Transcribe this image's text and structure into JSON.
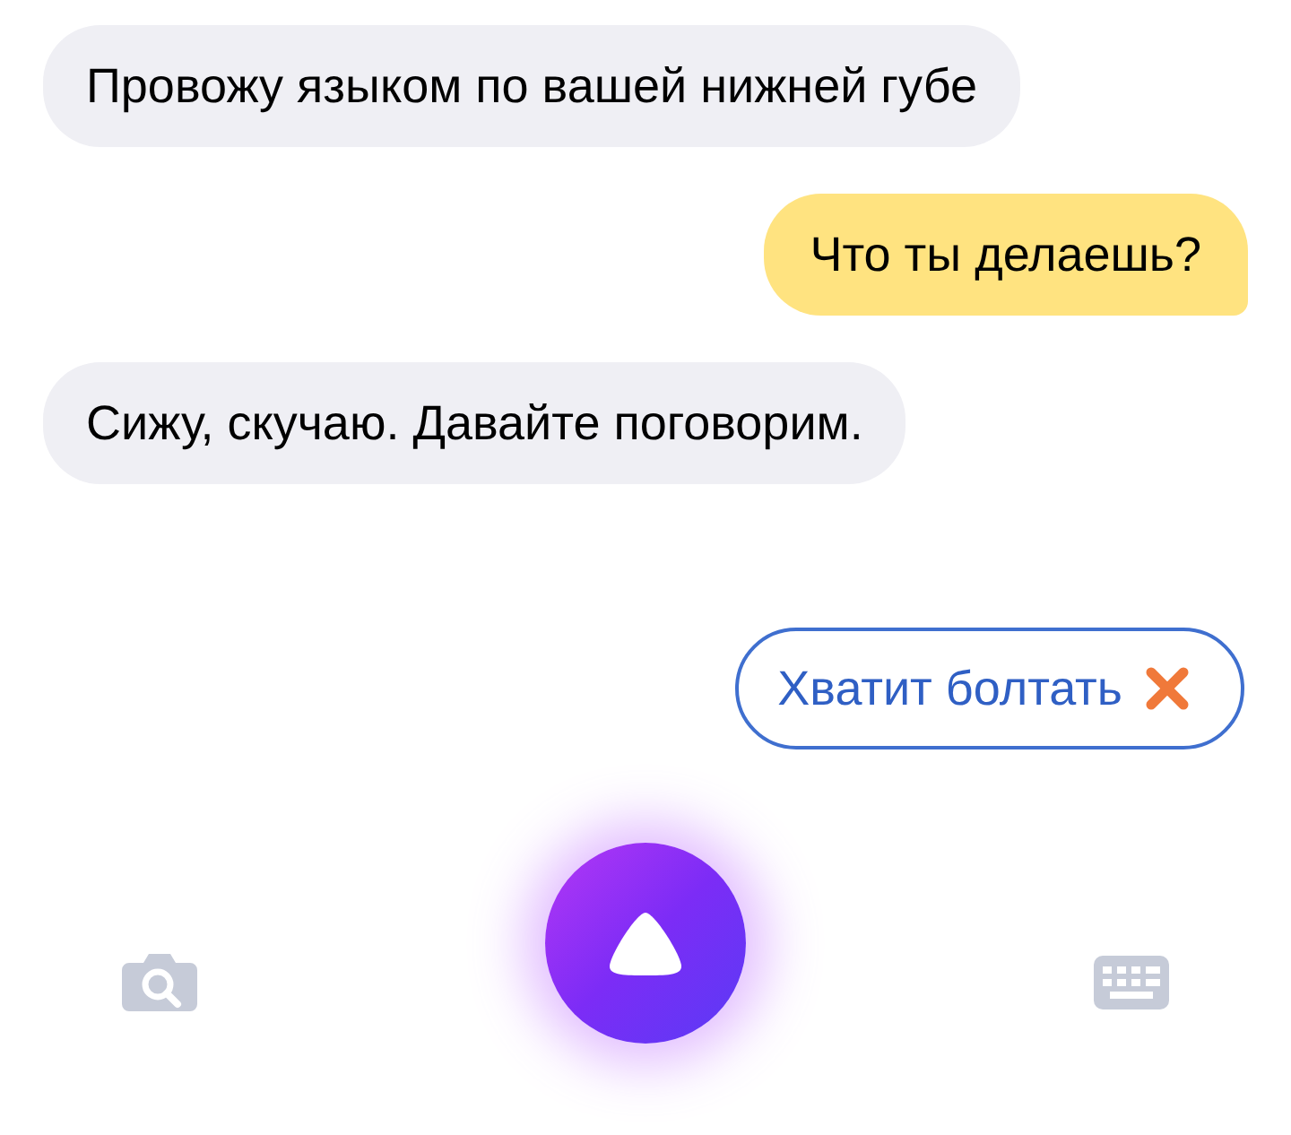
{
  "messages": [
    {
      "kind": "received",
      "text": "Провожу языком по вашей нижней губе"
    },
    {
      "kind": "sent",
      "text": "Что ты делаешь?"
    },
    {
      "kind": "received",
      "text": "Сижу, скучаю. Давайте поговорим."
    }
  ],
  "suggestions": [
    {
      "label": "Хватит болтать"
    }
  ]
}
